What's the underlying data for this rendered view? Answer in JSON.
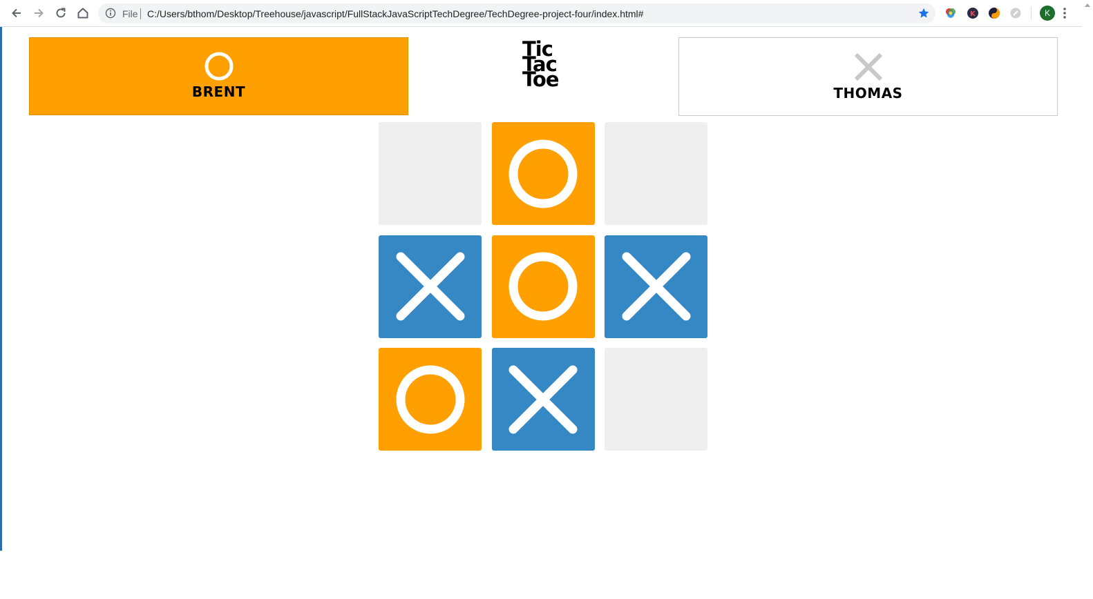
{
  "browser": {
    "scheme_label": "File",
    "url": "C:/Users/bthom/Desktop/Treehouse/javascript/FullStackJavaScriptTechDegree/TechDegree-project-four/index.html#",
    "profile_initial": "K",
    "accent_color": "#1a73e8"
  },
  "game": {
    "title_lines": [
      "Tic",
      "Tac",
      "Toe"
    ],
    "player_o": {
      "name": "BRENT",
      "symbol": "o-icon",
      "active": true,
      "color": "#ffa000"
    },
    "player_x": {
      "name": "THOMAS",
      "symbol": "x-icon",
      "active": false,
      "color": "#3688c4"
    },
    "board": [
      "",
      "o",
      "",
      "x",
      "o",
      "x",
      "o",
      "x",
      ""
    ],
    "colors": {
      "o": "#ffa000",
      "x": "#3688c4",
      "empty": "#efefef"
    }
  }
}
